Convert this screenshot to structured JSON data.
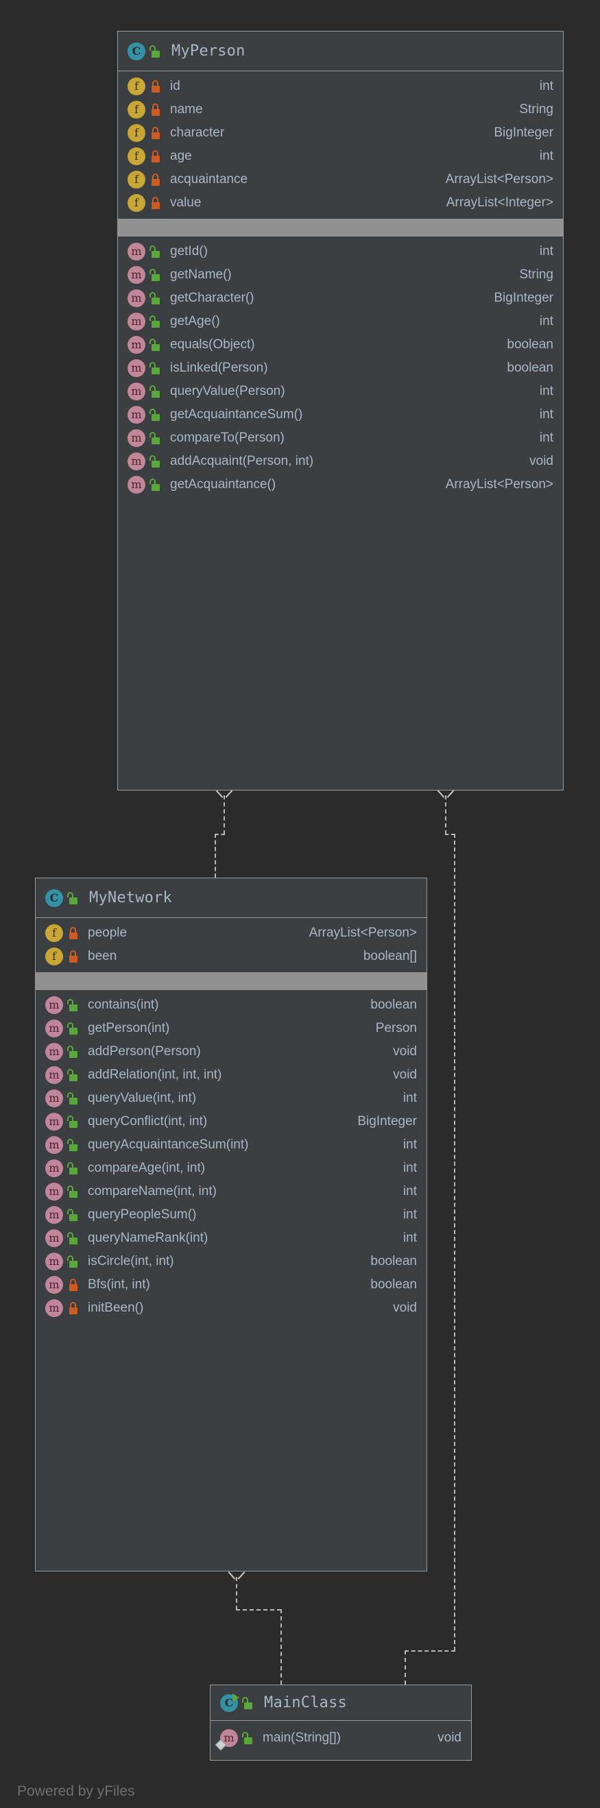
{
  "canvas": {
    "background": "#2b2b2b",
    "watermark": "Powered by yFiles"
  },
  "palette": {
    "box_fill": "#3c3f41",
    "box_border": "#9a9a9a",
    "divider": "#919191",
    "text": "#a9b7c6",
    "class_icon": "#3592a4",
    "field_icon": "#c9a736",
    "method_icon": "#c2869b",
    "lock_public": "#59a83a",
    "lock_private": "#cf5b23",
    "edge": "#b9b9b9"
  },
  "classes": [
    {
      "id": "myperson",
      "name": "MyPerson",
      "icon": "class-icon",
      "visibility": "public",
      "fields": [
        {
          "icon": "field-icon",
          "visibility": "private",
          "name": "id",
          "type": "int"
        },
        {
          "icon": "field-icon",
          "visibility": "private",
          "name": "name",
          "type": "String"
        },
        {
          "icon": "field-icon",
          "visibility": "private",
          "name": "character",
          "type": "BigInteger"
        },
        {
          "icon": "field-icon",
          "visibility": "private",
          "name": "age",
          "type": "int"
        },
        {
          "icon": "field-icon",
          "visibility": "private",
          "name": "acquaintance",
          "type": "ArrayList<Person>"
        },
        {
          "icon": "field-icon",
          "visibility": "private",
          "name": "value",
          "type": "ArrayList<Integer>"
        }
      ],
      "methods": [
        {
          "icon": "method-icon",
          "visibility": "public",
          "name": "getId()",
          "type": "int"
        },
        {
          "icon": "method-icon",
          "visibility": "public",
          "name": "getName()",
          "type": "String"
        },
        {
          "icon": "method-icon",
          "visibility": "public",
          "name": "getCharacter()",
          "type": "BigInteger"
        },
        {
          "icon": "method-icon",
          "visibility": "public",
          "name": "getAge()",
          "type": "int"
        },
        {
          "icon": "method-icon",
          "visibility": "public",
          "name": "equals(Object)",
          "type": "boolean"
        },
        {
          "icon": "method-icon",
          "visibility": "public",
          "name": "isLinked(Person)",
          "type": "boolean"
        },
        {
          "icon": "method-icon",
          "visibility": "public",
          "name": "queryValue(Person)",
          "type": "int"
        },
        {
          "icon": "method-icon",
          "visibility": "public",
          "name": "getAcquaintanceSum()",
          "type": "int"
        },
        {
          "icon": "method-icon",
          "visibility": "public",
          "name": "compareTo(Person)",
          "type": "int"
        },
        {
          "icon": "method-icon",
          "visibility": "public",
          "name": "addAcquaint(Person, int)",
          "type": "void"
        },
        {
          "icon": "method-icon",
          "visibility": "public",
          "name": "getAcquaintance()",
          "type": "ArrayList<Person>"
        }
      ]
    },
    {
      "id": "mynetwork",
      "name": "MyNetwork",
      "icon": "class-icon",
      "visibility": "public",
      "fields": [
        {
          "icon": "field-icon",
          "visibility": "private",
          "name": "people",
          "type": "ArrayList<Person>"
        },
        {
          "icon": "field-icon",
          "visibility": "private",
          "name": "been",
          "type": "boolean[]"
        }
      ],
      "methods": [
        {
          "icon": "method-icon",
          "visibility": "public",
          "name": "contains(int)",
          "type": "boolean"
        },
        {
          "icon": "method-icon",
          "visibility": "public",
          "name": "getPerson(int)",
          "type": "Person"
        },
        {
          "icon": "method-icon",
          "visibility": "public",
          "name": "addPerson(Person)",
          "type": "void"
        },
        {
          "icon": "method-icon",
          "visibility": "public",
          "name": "addRelation(int, int, int)",
          "type": "void"
        },
        {
          "icon": "method-icon",
          "visibility": "public",
          "name": "queryValue(int, int)",
          "type": "int"
        },
        {
          "icon": "method-icon",
          "visibility": "public",
          "name": "queryConflict(int, int)",
          "type": "BigInteger"
        },
        {
          "icon": "method-icon",
          "visibility": "public",
          "name": "queryAcquaintanceSum(int)",
          "type": "int"
        },
        {
          "icon": "method-icon",
          "visibility": "public",
          "name": "compareAge(int, int)",
          "type": "int"
        },
        {
          "icon": "method-icon",
          "visibility": "public",
          "name": "compareName(int, int)",
          "type": "int"
        },
        {
          "icon": "method-icon",
          "visibility": "public",
          "name": "queryPeopleSum()",
          "type": "int"
        },
        {
          "icon": "method-icon",
          "visibility": "public",
          "name": "queryNameRank(int)",
          "type": "int"
        },
        {
          "icon": "method-icon",
          "visibility": "public",
          "name": "isCircle(int, int)",
          "type": "boolean"
        },
        {
          "icon": "method-icon",
          "visibility": "private",
          "name": "Bfs(int, int)",
          "type": "boolean"
        },
        {
          "icon": "method-icon",
          "visibility": "private",
          "name": "initBeen()",
          "type": "void"
        }
      ]
    },
    {
      "id": "mainclass",
      "name": "MainClass",
      "icon": "class-runnable-icon",
      "visibility": "public",
      "fields": [],
      "methods": [
        {
          "icon": "method-static-icon",
          "visibility": "public",
          "name": "main(String[])",
          "type": "void"
        }
      ]
    }
  ],
  "edges": [
    {
      "name": "edge-mynetwork-to-myperson",
      "type": "realization-dashed-arrow",
      "from": "MyNetwork",
      "to": "MyPerson"
    },
    {
      "name": "edge-mainclass-to-myperson",
      "type": "realization-dashed-arrow",
      "from": "MainClass",
      "to": "MyPerson"
    },
    {
      "name": "edge-mainclass-to-mynetwork",
      "type": "realization-dashed-arrow",
      "from": "MainClass",
      "to": "MyNetwork"
    }
  ]
}
